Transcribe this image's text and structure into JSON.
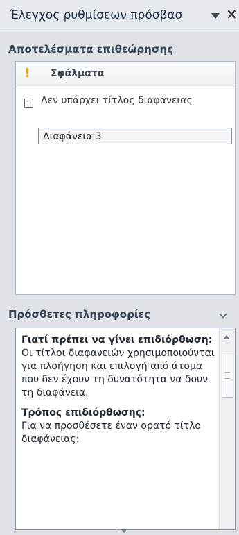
{
  "pane": {
    "title": "Έλεγχος ρυθμίσεων πρόσβασ",
    "close_glyph": "×"
  },
  "inspection": {
    "heading": "Αποτελέσματα επιθεώρησης",
    "errors_label": "Σφάλματα",
    "warning_glyph": "!",
    "rule_text": "Δεν υπάρχει τίτλος διαφάνειας",
    "selected_slide": "Διαφάνεια 3"
  },
  "additional_info": {
    "heading": "Πρόσθετες πληροφορίες",
    "why_heading": "Γιατί πρέπει να γίνει επιδιόρθωση:",
    "why_text": "Οι τίτλοι διαφανειών χρησιμοποιούνται για πλοήγηση και επιλογή από άτομα που δεν έχουν τη δυνατότητα να δουν τη διαφάνεια.",
    "how_heading": "Τρόπος επιδιόρθωσης:",
    "how_text": "Για να προσθέσετε έναν ορατό τίτλο διαφάνειας:"
  },
  "colors": {
    "warning": "#e8a317",
    "pane_bg": "#dfe3e8"
  }
}
